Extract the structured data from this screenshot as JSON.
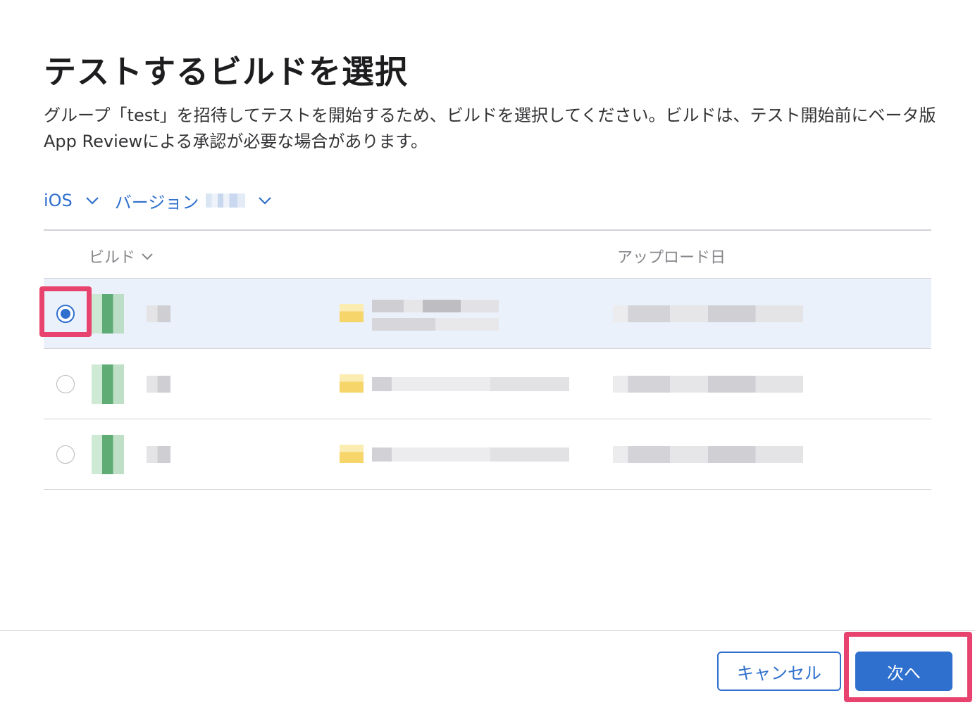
{
  "dialog": {
    "title": "テストするビルドを選択",
    "description": "グループ「test」を招待してテストを開始するため、ビルドを選択してください。ビルドは、テスト開始前にベータ版App Reviewによる承認が必要な場合があります。"
  },
  "filters": {
    "platform": "iOS",
    "version_label": "バージョン"
  },
  "table": {
    "columns": {
      "build": "ビルド",
      "upload_date": "アップロード日"
    },
    "rows": [
      {
        "selected": true
      },
      {
        "selected": false
      },
      {
        "selected": false
      }
    ]
  },
  "footer": {
    "cancel_label": "キャンセル",
    "next_label": "次へ"
  },
  "colors": {
    "accent": "#2f6fce",
    "highlight": "#e8436e",
    "selected_row": "#eaf1fa"
  },
  "icons": [
    "chevron-down-icon",
    "radio-icon",
    "app-icon"
  ]
}
